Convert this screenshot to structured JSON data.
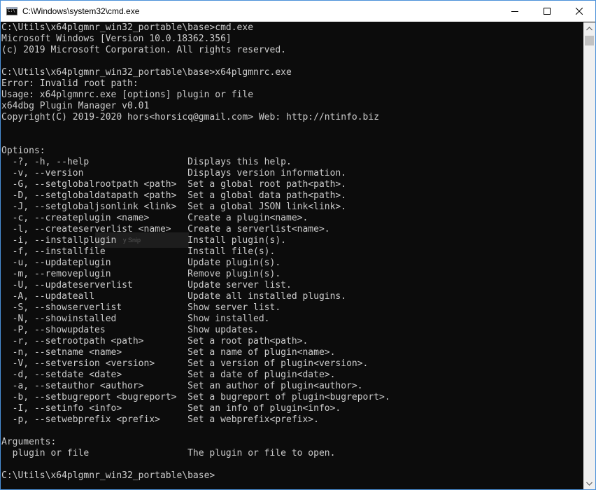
{
  "window": {
    "title": "C:\\Windows\\system32\\cmd.exe",
    "icon_label": "C:\\"
  },
  "caption_buttons": {
    "minimize": "minimize-icon",
    "maximize": "maximize-icon",
    "close": "close-icon"
  },
  "console": {
    "lines": [
      "C:\\Utils\\x64plgmnr_win32_portable\\base>cmd.exe",
      "Microsoft Windows [Version 10.0.18362.356]",
      "(c) 2019 Microsoft Corporation. All rights reserved.",
      "",
      "C:\\Utils\\x64plgmnr_win32_portable\\base>x64plgmnrc.exe",
      "Error: Invalid root path:",
      "Usage: x64plgmnrc.exe [options] plugin or file",
      "x64dbg Plugin Manager v0.01",
      "Copyright(C) 2019-2020 hors<horsicq@gmail.com> Web: http://ntinfo.biz",
      "",
      "",
      "Options:",
      "  -?, -h, --help                  Displays this help.",
      "  -v, --version                   Displays version information.",
      "  -G, --setglobalrootpath <path>  Set a global root path<path>.",
      "  -D, --setglobaldatapath <path>  Set a global data path<path>.",
      "  -J, --setglobaljsonlink <link>  Set a global JSON link<link>.",
      "  -c, --createplugin <name>       Create a plugin<name>.",
      "  -l, --createserverlist <name>   Create a serverlist<name>.",
      "  -i, --installplugin             Install plugin(s).",
      "  -f, --installfile               Install file(s).",
      "  -u, --updateplugin              Update plugin(s).",
      "  -m, --removeplugin              Remove plugin(s).",
      "  -U, --updateserverlist          Update server list.",
      "  -A, --updateall                 Update all installed plugins.",
      "  -S, --showserverlist            Show server list.",
      "  -N, --showinstalled             Show installed.",
      "  -P, --showupdates               Show updates.",
      "  -r, --setrootpath <path>        Set a root path<path>.",
      "  -n, --setname <name>            Set a name of plugin<name>.",
      "  -V, --setversion <version>      Set a version of plugin<version>.",
      "  -d, --setdate <date>            Set a date of plugin<date>.",
      "  -a, --setauthor <author>        Set an author of plugin<author>.",
      "  -b, --setbugreport <bugreport>  Set a bugreport of plugin<bugreport>.",
      "  -I, --setinfo <info>            Set an info of plugin<info>.",
      "  -p, --setwebprefix <prefix>     Set a webprefix<prefix>.",
      "",
      "Arguments:",
      "  plugin or file                  The plugin or file to open.",
      "",
      "C:\\Utils\\x64plgmnr_win32_portable\\base>"
    ],
    "overlay_text": "y Snip"
  },
  "scrollbar": {
    "up": "scroll-up-arrow-icon",
    "down": "scroll-down-arrow-icon"
  },
  "colors": {
    "console_bg": "#0c0c0c",
    "console_fg": "#cccccc",
    "titlebar_bg": "#ffffff",
    "window_border": "#4a90d9"
  }
}
